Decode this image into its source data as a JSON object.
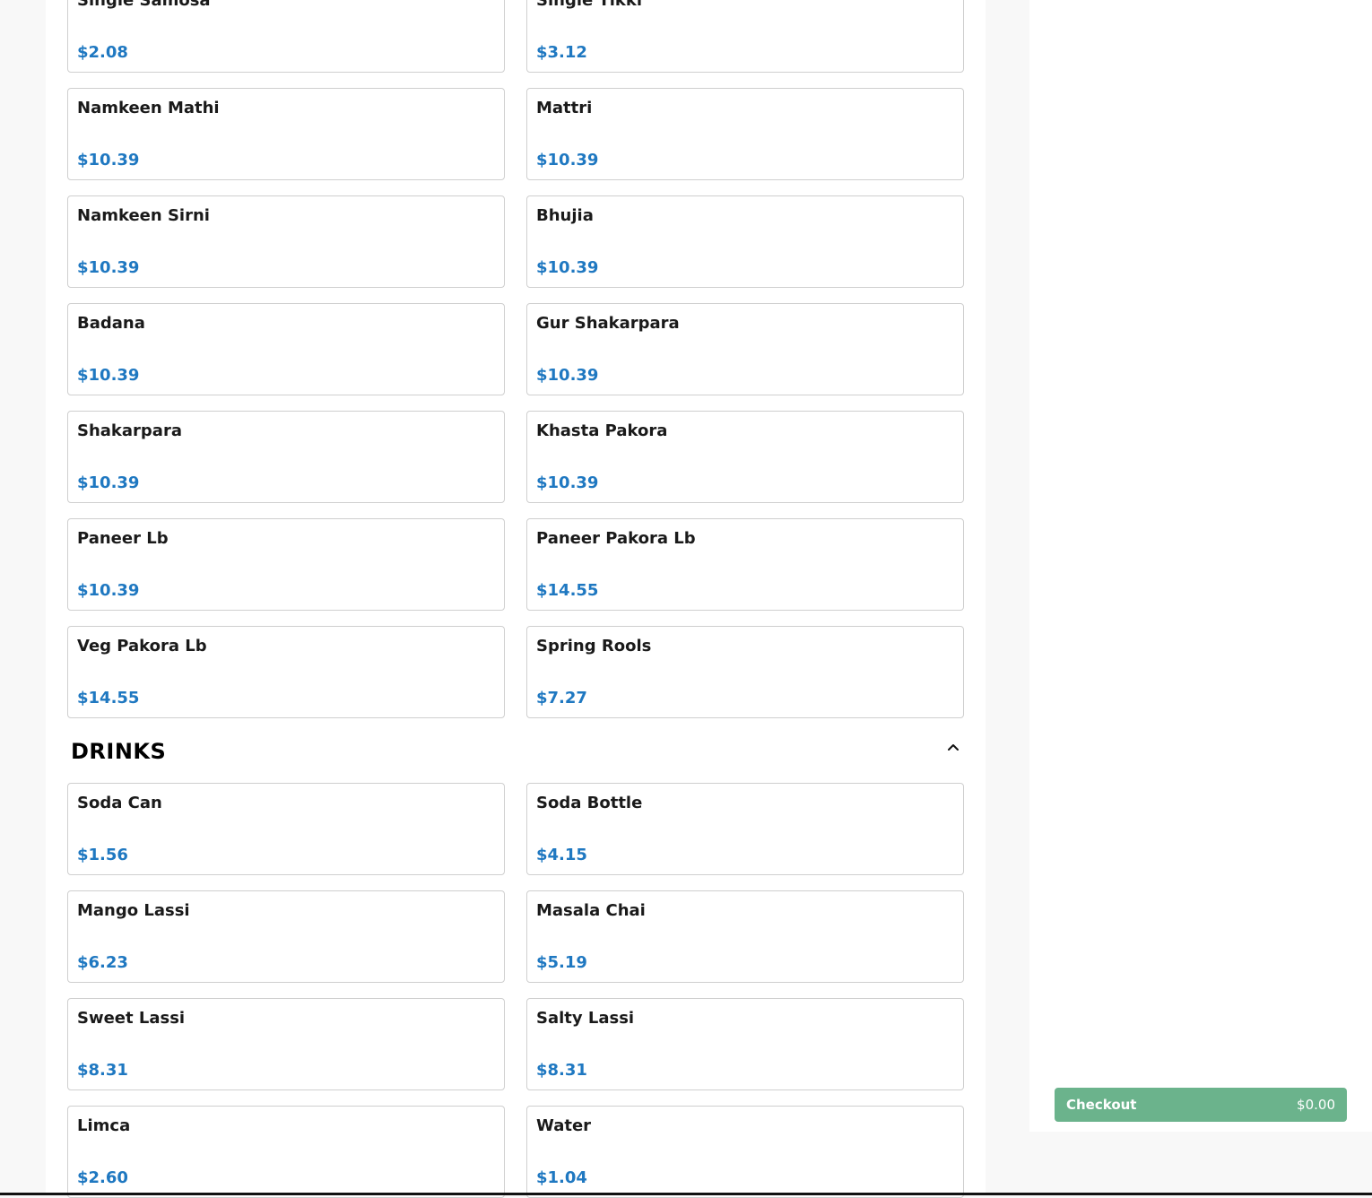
{
  "snacks": {
    "items": [
      {
        "name": "Single Samosa",
        "price": "$2.08"
      },
      {
        "name": "Single Tikki",
        "price": "$3.12"
      },
      {
        "name": "Namkeen Mathi",
        "price": "$10.39"
      },
      {
        "name": "Mattri",
        "price": "$10.39"
      },
      {
        "name": "Namkeen Sirni",
        "price": "$10.39"
      },
      {
        "name": "Bhujia",
        "price": "$10.39"
      },
      {
        "name": "Badana",
        "price": "$10.39"
      },
      {
        "name": "Gur Shakarpara",
        "price": "$10.39"
      },
      {
        "name": "Shakarpara",
        "price": "$10.39"
      },
      {
        "name": "Khasta Pakora",
        "price": "$10.39"
      },
      {
        "name": "Paneer Lb",
        "price": "$10.39"
      },
      {
        "name": "Paneer Pakora Lb",
        "price": "$14.55"
      },
      {
        "name": "Veg Pakora Lb",
        "price": "$14.55"
      },
      {
        "name": "Spring Rools",
        "price": "$7.27"
      }
    ]
  },
  "drinks": {
    "title": "DRINKS",
    "items": [
      {
        "name": "Soda Can",
        "price": "$1.56"
      },
      {
        "name": "Soda Bottle",
        "price": "$4.15"
      },
      {
        "name": "Mango Lassi",
        "price": "$6.23"
      },
      {
        "name": "Masala Chai",
        "price": "$5.19"
      },
      {
        "name": "Sweet Lassi",
        "price": "$8.31"
      },
      {
        "name": "Salty Lassi",
        "price": "$8.31"
      },
      {
        "name": "Limca",
        "price": "$2.60"
      },
      {
        "name": "Water",
        "price": "$1.04"
      }
    ]
  },
  "cart": {
    "checkout_label": "Checkout",
    "total": "$0.00"
  },
  "colors": {
    "price": "#1f78c1",
    "checkout": "#6bb38c"
  },
  "icons": {
    "collapse": "chevron-up-icon"
  }
}
